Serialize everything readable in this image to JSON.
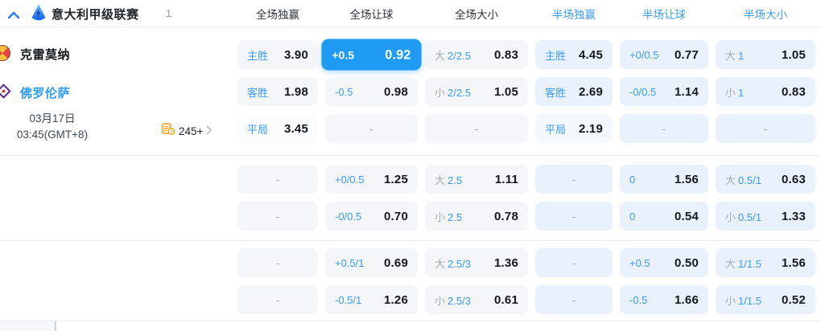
{
  "league_header": {
    "name": "意大利甲级联赛",
    "count": "1",
    "columns": [
      {
        "label": "全场独赢",
        "half": false
      },
      {
        "label": "全场让球",
        "half": false
      },
      {
        "label": "全场大小",
        "half": false
      },
      {
        "label": "半场独赢",
        "half": true
      },
      {
        "label": "半场让球",
        "half": true
      },
      {
        "label": "半场大小",
        "half": true
      }
    ]
  },
  "match": {
    "home_team": "克雷莫纳",
    "away_team": "佛罗伦萨",
    "date": "03月17日",
    "time": "03:45(GMT+8)",
    "markets_count": "245+"
  },
  "dash": "-",
  "odds": {
    "groups": [
      {
        "rows": [
          {
            "cells": [
              {
                "label": "主胜",
                "value": "3.90"
              },
              {
                "label": "+0.5",
                "value": "0.92",
                "selected": true
              },
              {
                "prefix": "大",
                "label": "2/2.5",
                "value": "0.83"
              },
              {
                "label": "主胜",
                "value": "4.45"
              },
              {
                "label": "+0/0.5",
                "value": "0.77"
              },
              {
                "prefix": "大",
                "label": "1",
                "value": "1.05"
              }
            ]
          },
          {
            "cells": [
              {
                "label": "客胜",
                "value": "1.98"
              },
              {
                "label": "-0.5",
                "value": "0.98"
              },
              {
                "prefix": "小",
                "label": "2/2.5",
                "value": "1.05"
              },
              {
                "label": "客胜",
                "value": "2.69"
              },
              {
                "label": "-0/0.5",
                "value": "1.14"
              },
              {
                "prefix": "小",
                "label": "1",
                "value": "0.83"
              }
            ]
          },
          {
            "cells": [
              {
                "label": "平局",
                "value": "3.45",
                "light": true
              },
              {
                "dash": true
              },
              {
                "dash": true
              },
              {
                "label": "平局",
                "value": "2.19",
                "light": true
              },
              {
                "dash": true
              },
              {
                "dash": true
              }
            ]
          }
        ]
      },
      {
        "rows": [
          {
            "cells": [
              {
                "dash": true
              },
              {
                "label": "+0/0.5",
                "value": "1.25"
              },
              {
                "prefix": "大",
                "label": "2.5",
                "value": "1.11"
              },
              {
                "dash": true
              },
              {
                "label": "0",
                "value": "1.56"
              },
              {
                "prefix": "大",
                "label": "0.5/1",
                "value": "0.63"
              }
            ]
          },
          {
            "cells": [
              {
                "dash": true
              },
              {
                "label": "-0/0.5",
                "value": "0.70"
              },
              {
                "prefix": "小",
                "label": "2.5",
                "value": "0.78"
              },
              {
                "dash": true
              },
              {
                "label": "0",
                "value": "0.54"
              },
              {
                "prefix": "小",
                "label": "0.5/1",
                "value": "1.33"
              }
            ]
          }
        ]
      },
      {
        "rows": [
          {
            "cells": [
              {
                "dash": true
              },
              {
                "label": "+0.5/1",
                "value": "0.69"
              },
              {
                "prefix": "大",
                "label": "2.5/3",
                "value": "1.36"
              },
              {
                "dash": true
              },
              {
                "label": "+0.5",
                "value": "0.50"
              },
              {
                "prefix": "大",
                "label": "1/1.5",
                "value": "1.56"
              }
            ]
          },
          {
            "cells": [
              {
                "dash": true
              },
              {
                "label": "-0.5/1",
                "value": "1.26"
              },
              {
                "prefix": "小",
                "label": "2.5/3",
                "value": "0.61"
              },
              {
                "dash": true
              },
              {
                "label": "-0.5",
                "value": "1.66"
              },
              {
                "prefix": "小",
                "label": "1/1.5",
                "value": "0.52"
              }
            ]
          }
        ]
      }
    ]
  },
  "icons": {
    "chevron_up": "collapse-league-section",
    "league_logo": "serie-a-badge",
    "home_badge": "cremonese-crest",
    "away_badge": "fiorentina-crest",
    "coins": "markets-count",
    "chevron_right": "open-match-detail"
  },
  "colors": {
    "accent_blue": "#3b9cf6",
    "selected_cell_bg": "#1f9bf3",
    "cell_full_bg": "#f4f6fa",
    "cell_half_bg": "#e9f2fc",
    "orange": "#f5a623",
    "dark_text": "#14181c"
  }
}
